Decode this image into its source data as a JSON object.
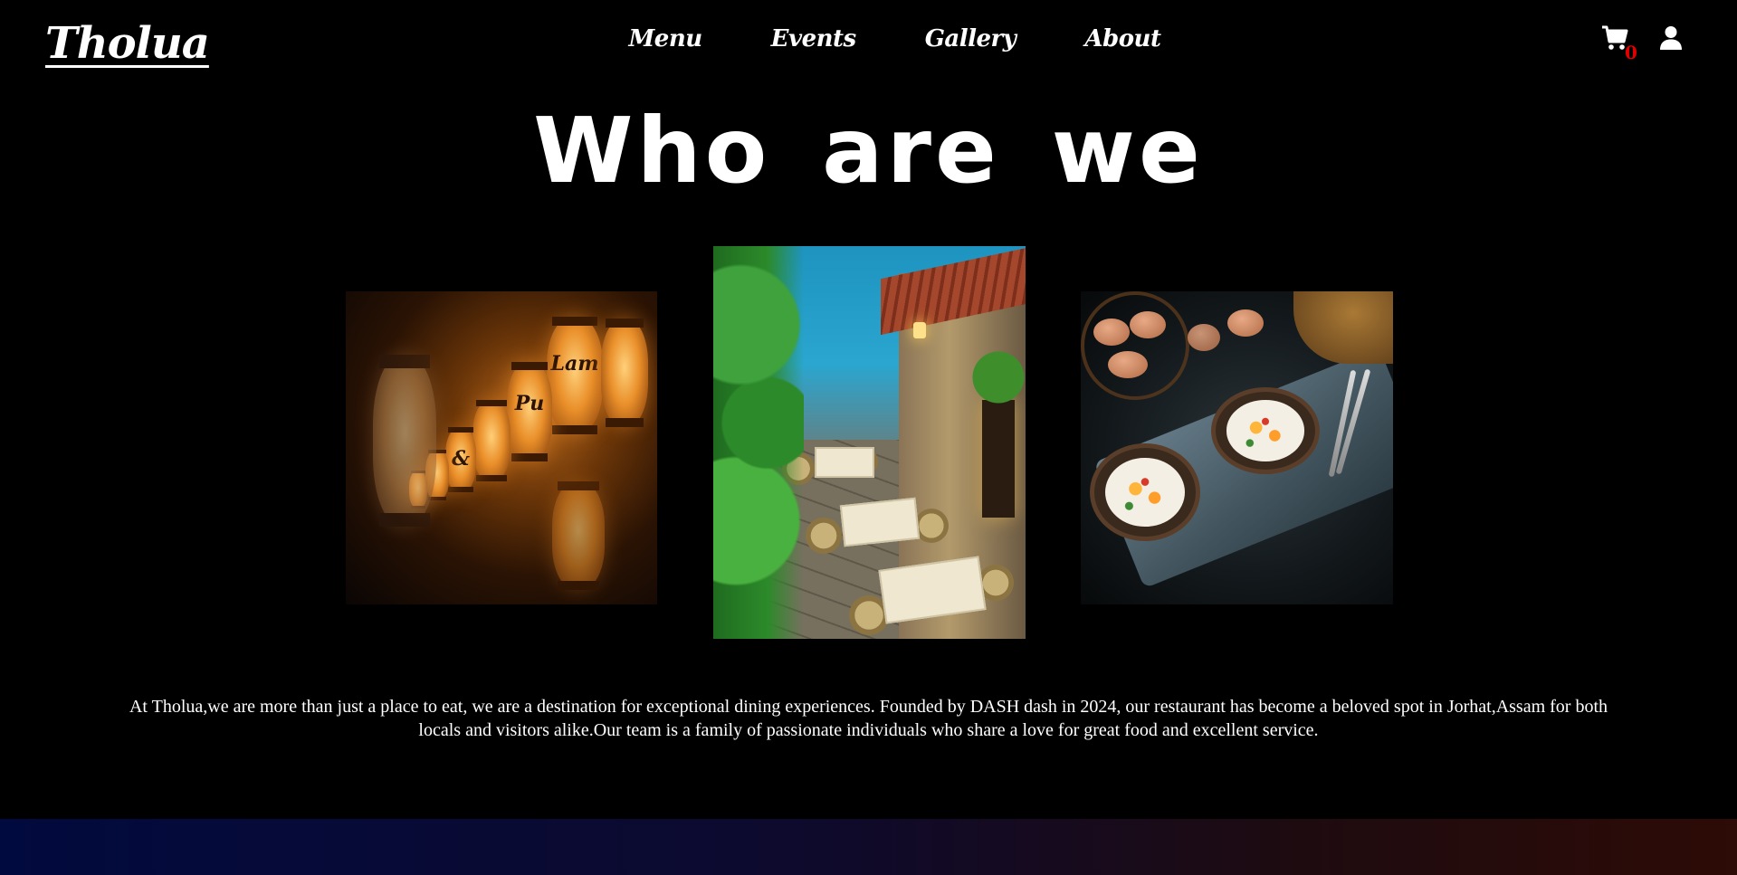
{
  "header": {
    "logo": "Tholua",
    "nav": [
      "Menu",
      "Events",
      "Gallery",
      "About"
    ],
    "cart_count": "0",
    "icons": {
      "cart": "cart-icon",
      "user": "user-icon"
    },
    "cart_count_color": "#e00000"
  },
  "main": {
    "title": "Who are we",
    "about_text": "At Tholua,we are more than just a place to eat, we are a destination for exceptional dining experiences. Founded by DASH dash in 2024, our restaurant has become a beloved spot in Jorhat,Assam for both locals and visitors alike.Our team is a family of passionate individuals who share a love for great food and excellent service.",
    "lantern_glyphs": [
      "Lam",
      "Pu",
      "&"
    ]
  },
  "theme": {
    "background": "#000000",
    "text": "#ffffff",
    "footer_gradient": [
      "#010a3e",
      "#2d0b06"
    ]
  }
}
